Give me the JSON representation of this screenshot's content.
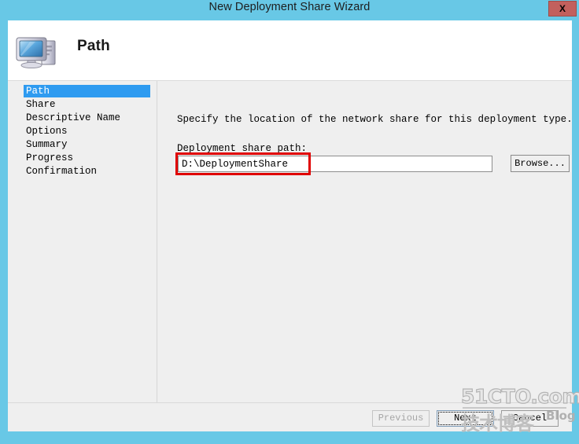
{
  "window": {
    "title": "New Deployment Share Wizard",
    "close_label": "X",
    "frame_color": "#68c8e6",
    "close_button_color": "#c2605d"
  },
  "header": {
    "page_title": "Path",
    "icon": "computer-icon"
  },
  "sidebar": {
    "items": [
      {
        "label": "Path",
        "selected": true
      },
      {
        "label": "Share",
        "selected": false
      },
      {
        "label": "Descriptive Name",
        "selected": false
      },
      {
        "label": "Options",
        "selected": false
      },
      {
        "label": "Summary",
        "selected": false
      },
      {
        "label": "Progress",
        "selected": false
      },
      {
        "label": "Confirmation",
        "selected": false
      }
    ],
    "selected_color": "#2e9bf0"
  },
  "content": {
    "instruction": "Specify the location of the network share for this deployment type.",
    "field_label": "Deployment share path:",
    "path_value": "D:\\DeploymentShare",
    "path_placeholder": "",
    "browse_label": "Browse...",
    "highlight_color": "#e00000"
  },
  "footer": {
    "previous_label": "Previous",
    "previous_disabled": true,
    "next_label": "Next",
    "next_focused": true,
    "cancel_label": "Cancel"
  },
  "watermark": {
    "top_text": "51CTO.com",
    "chinese_text": "技术博客",
    "blog_text": "Blog"
  }
}
